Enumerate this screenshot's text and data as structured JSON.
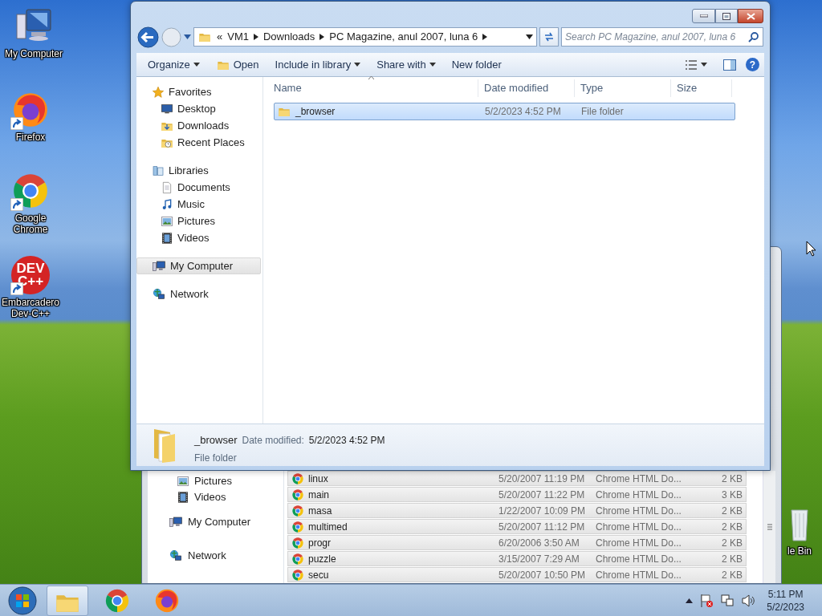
{
  "desktop_icons": [
    {
      "kind": "computer",
      "label": "My Computer",
      "shortcut": false
    },
    {
      "kind": "firefox",
      "label": "Firefox",
      "shortcut": true
    },
    {
      "kind": "chrome",
      "label": "Google Chrome",
      "shortcut": true
    },
    {
      "kind": "devcpp",
      "label": "Embarcadero Dev-C++",
      "shortcut": true,
      "logo_lines": [
        "DEV",
        "C++"
      ]
    }
  ],
  "recycle_bin": {
    "label": "le Bin"
  },
  "back_window": {
    "nav_items": [
      {
        "kind": "pictures",
        "label": "Pictures"
      },
      {
        "kind": "videos",
        "label": "Videos"
      },
      {
        "kind": "computer",
        "label": "My Computer"
      },
      {
        "kind": "network",
        "label": "Network"
      }
    ],
    "files": [
      {
        "name": "linux",
        "date": "5/20/2007 11:19 PM",
        "type": "Chrome HTML Do...",
        "size": "2 KB",
        "selected": true
      },
      {
        "name": "main",
        "date": "5/20/2007 11:22 PM",
        "type": "Chrome HTML Do...",
        "size": "3 KB",
        "selected": true
      },
      {
        "name": "masa",
        "date": "1/22/2007 10:09 PM",
        "type": "Chrome HTML Do...",
        "size": "2 KB",
        "selected": true
      },
      {
        "name": "multimed",
        "date": "5/20/2007 11:12 PM",
        "type": "Chrome HTML Do...",
        "size": "2 KB",
        "selected": true
      },
      {
        "name": "progr",
        "date": "6/20/2006 3:50 AM",
        "type": "Chrome HTML Do...",
        "size": "2 KB",
        "selected": true
      },
      {
        "name": "puzzle",
        "date": "3/15/2007 7:29 AM",
        "type": "Chrome HTML Do...",
        "size": "2 KB",
        "selected": true
      },
      {
        "name": "secu",
        "date": "5/20/2007 10:50 PM",
        "type": "Chrome HTML Do...",
        "size": "2 KB",
        "selected": true
      }
    ]
  },
  "explorer": {
    "address": {
      "overflow": "«",
      "crumbs": [
        "VM1",
        "Downloads",
        "PC Magazine, anul 2007, luna 6"
      ]
    },
    "search": {
      "placeholder": "Search PC Magazine, anul 2007, luna 6"
    },
    "toolbar": [
      {
        "kind": "menu",
        "label": "Organize"
      },
      {
        "kind": "icon",
        "label": "Open"
      },
      {
        "kind": "menu",
        "label": "Include in library"
      },
      {
        "kind": "menu",
        "label": "Share with"
      },
      {
        "kind": "plain",
        "label": "New folder"
      }
    ],
    "help_glyph": "?",
    "nav_tree": [
      {
        "kind": "star",
        "label": "Favorites",
        "selected": false,
        "children": [
          {
            "kind": "desktop",
            "label": "Desktop",
            "selected": false
          },
          {
            "kind": "downloads",
            "label": "Downloads",
            "selected": false
          },
          {
            "kind": "recent",
            "label": "Recent Places",
            "selected": false
          }
        ]
      },
      {
        "kind": "library",
        "label": "Libraries",
        "selected": false,
        "children": [
          {
            "kind": "documents",
            "label": "Documents",
            "selected": false
          },
          {
            "kind": "music",
            "label": "Music",
            "selected": false
          },
          {
            "kind": "pictures",
            "label": "Pictures",
            "selected": false
          },
          {
            "kind": "videos",
            "label": "Videos",
            "selected": false
          }
        ]
      },
      {
        "kind": "computer",
        "label": "My Computer",
        "selected": true
      },
      {
        "kind": "network",
        "label": "Network",
        "selected": false
      }
    ],
    "columns": [
      "Name",
      "Date modified",
      "Type",
      "Size"
    ],
    "rows": [
      {
        "name": "_browser",
        "date": "5/2/2023 4:52 PM",
        "type": "File folder",
        "selected": true
      }
    ],
    "details": {
      "name": "_browser",
      "date_label": "Date modified:",
      "date": "5/2/2023 4:52 PM",
      "type": "File folder"
    }
  },
  "taskbar": {
    "apps": [
      {
        "kind": "explorer",
        "active": true
      },
      {
        "kind": "chrome",
        "active": false
      },
      {
        "kind": "firefox",
        "active": false
      }
    ],
    "tray": [
      {
        "kind": "up"
      },
      {
        "kind": "flag"
      },
      {
        "kind": "network"
      },
      {
        "kind": "speaker"
      }
    ],
    "clock": {
      "time": "5:11 PM",
      "date": "5/2/2023"
    }
  }
}
